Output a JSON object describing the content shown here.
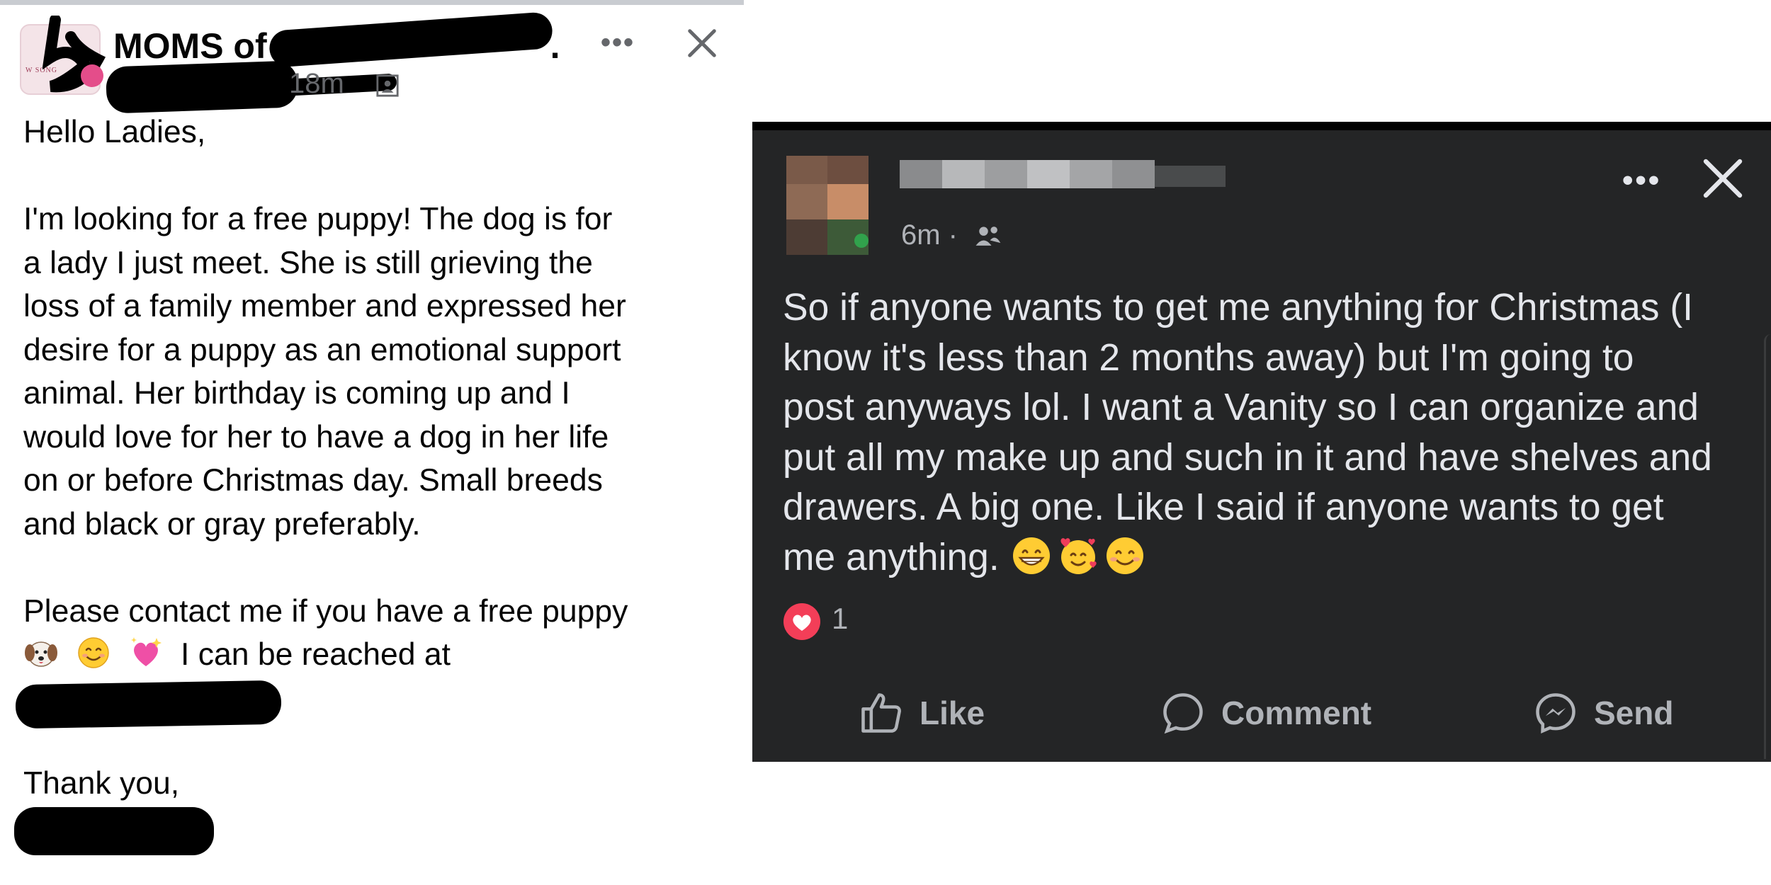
{
  "left_post": {
    "group_avatar_text": "W SONG",
    "group_name": "MOMS of",
    "group_name_suffix": ".",
    "time": "18m",
    "more_label": "•••",
    "lines": [
      "Hello  Ladies,",
      "",
      "I'm looking for a free puppy! The dog is for",
      "a  lady I just meet. She is still grieving the",
      "loss of a family member and expressed her",
      "desire for a puppy as an emotional support",
      "animal. Her birthday is coming up and I",
      "would love for her to have a dog in her life",
      "on or before Christmas day. Small breeds",
      "and black or gray preferably.",
      "",
      "Please contact me if you have a free puppy"
    ],
    "reach_line": "I can be reached at",
    "emojis": [
      "dog-face-icon",
      "smiling-face-icon",
      "sparkling-heart-icon"
    ],
    "thank_you": "Thank you,"
  },
  "right_post": {
    "time": "6m ·",
    "more_label": "•••",
    "lines": [
      "So if anyone wants to get me anything for Christmas (I",
      "know it's less than 2 months away) but I'm going to",
      "post anyways lol. I want a Vanity so I can organize and",
      "put all my make up and such in it and have shelves and",
      "drawers. A big one. Like I said if anyone wants to get"
    ],
    "last_line": "me anything.",
    "emojis": [
      "grinning-face-icon",
      "smiling-face-with-hearts-icon",
      "smiling-face-icon"
    ],
    "reaction_count": "1",
    "actions": {
      "like": "Like",
      "comment": "Comment",
      "send": "Send"
    }
  },
  "colors": {
    "dark_bg": "#242526",
    "dark_text": "#e4e6eb",
    "dark_secondary": "#b0b3b8",
    "love_reaction": "#f33e58",
    "light_text": "#050505",
    "light_secondary": "#65676b"
  }
}
